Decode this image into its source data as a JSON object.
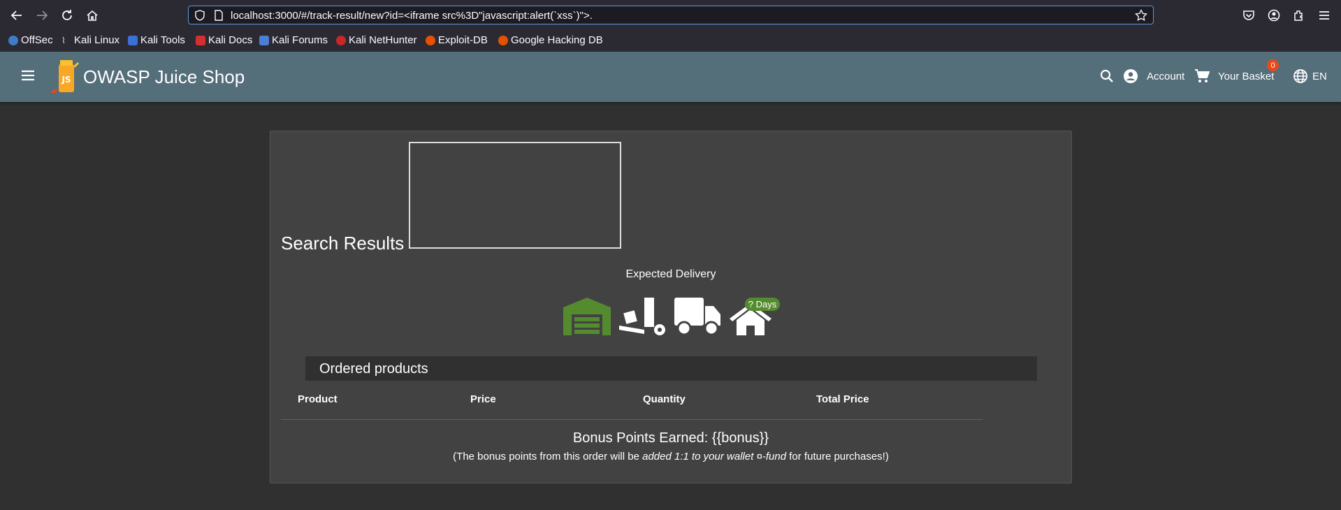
{
  "browser": {
    "url": "localhost:3000/#/track-result/new?id=<iframe src%3D\"javascript:alert(`xss`)\">.",
    "bookmarks": [
      {
        "label": "OffSec",
        "color": "#3d7cc9"
      },
      {
        "label": "Kali Linux",
        "color": "#222222"
      },
      {
        "label": "Kali Tools",
        "color": "#3d6fd8"
      },
      {
        "label": "Kali Docs",
        "color": "#d32f2f"
      },
      {
        "label": "Kali Forums",
        "color": "#4a7fd8"
      },
      {
        "label": "Kali NetHunter",
        "color": "#c62828"
      },
      {
        "label": "Exploit-DB",
        "color": "#e65100"
      },
      {
        "label": "Google Hacking DB",
        "color": "#e65100"
      }
    ]
  },
  "app": {
    "title": "OWASP Juice Shop",
    "toolbar_color": "#546e7a",
    "account_label": "Account",
    "basket_label": "Your Basket",
    "basket_count": "0",
    "language": "EN"
  },
  "track": {
    "search_label": "Search Results -",
    "expected_delivery": "Expected Delivery",
    "days_badge": "? Days",
    "progress_stage_active": "warehouse",
    "active_color": "#558b2f"
  },
  "order": {
    "section_title": "Ordered products",
    "columns": [
      "Product",
      "Price",
      "Quantity",
      "Total Price"
    ],
    "bonus_text": "Bonus Points Earned: {{bonus}}",
    "note_prefix": "(The bonus points from this order will be ",
    "note_emphasis": "added 1:1 to your wallet ¤-fund",
    "note_suffix": " for future purchases!)"
  }
}
